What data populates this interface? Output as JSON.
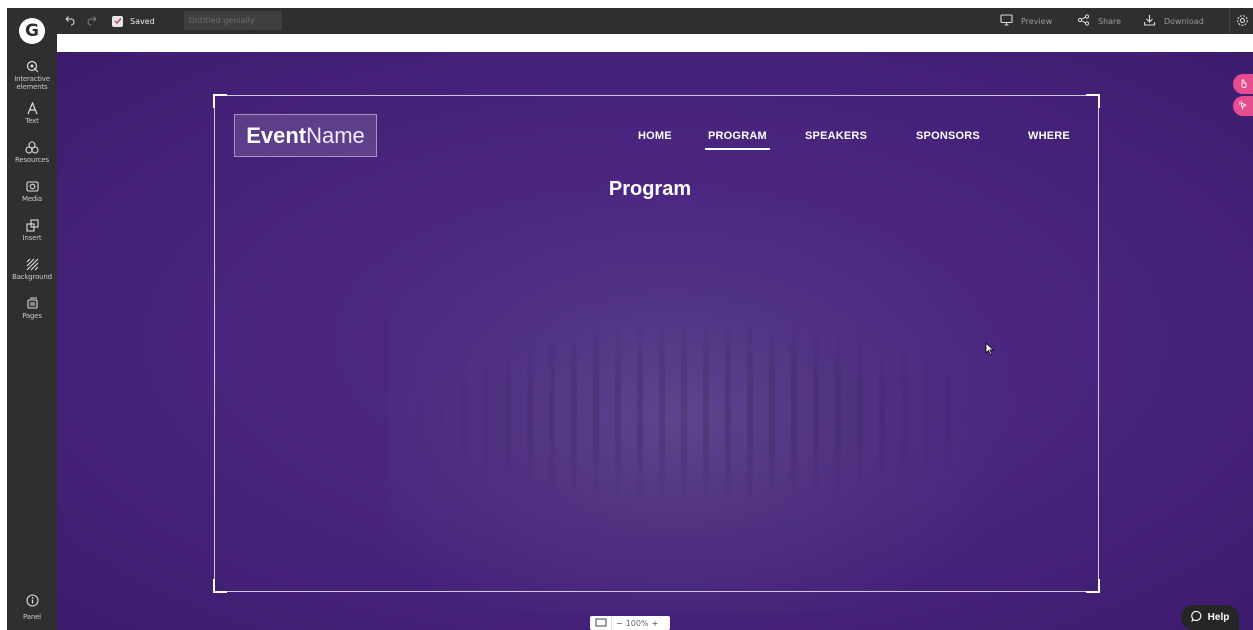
{
  "app": {
    "logo_letter": "G"
  },
  "sidebar": {
    "items": [
      {
        "label": "Interactive elements",
        "icon": "interactive-elements-icon"
      },
      {
        "label": "Text",
        "icon": "text-icon"
      },
      {
        "label": "Resources",
        "icon": "resources-icon"
      },
      {
        "label": "Media",
        "icon": "media-icon"
      },
      {
        "label": "Insert",
        "icon": "insert-icon"
      },
      {
        "label": "Background",
        "icon": "background-icon"
      },
      {
        "label": "Pages",
        "icon": "pages-icon"
      }
    ],
    "panel_label": "Panel"
  },
  "topbar": {
    "saved_label": "Saved",
    "title_placeholder": "Untitled genially",
    "preview_label": "Preview",
    "share_label": "Share",
    "download_label": "Download"
  },
  "slide": {
    "brand_bold": "Event",
    "brand_light": "Name",
    "nav": [
      "HOME",
      "PROGRAM",
      "SPEAKERS",
      "SPONSORS",
      "WHERE"
    ],
    "active_nav": "PROGRAM",
    "heading": "Program"
  },
  "zoom": {
    "minus": "−",
    "level": "100%",
    "plus": "+"
  },
  "help": {
    "label": "Help"
  },
  "colors": {
    "canvas": "#4a2680",
    "sidebar": "#2f2f2f",
    "accent_pink": "#e74c8e"
  }
}
